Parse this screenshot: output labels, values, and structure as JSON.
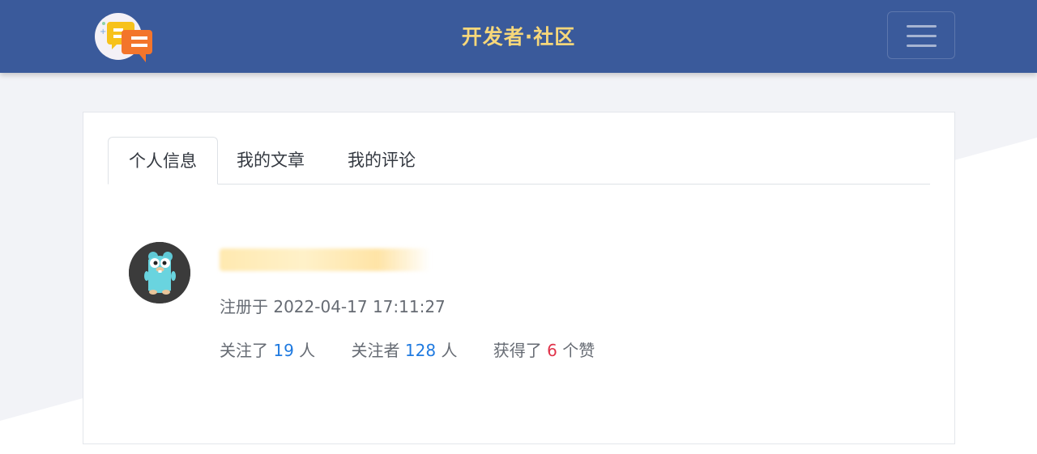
{
  "header": {
    "site_title": "开发者·社区",
    "logo_icon": "chat-bubbles-logo",
    "menu_icon": "hamburger-menu-icon",
    "bg_color": "#3a5a9b",
    "title_color": "#f6d77a"
  },
  "tabs": [
    {
      "label": "个人信息",
      "active": true
    },
    {
      "label": "我的文章",
      "active": false
    },
    {
      "label": "我的评论",
      "active": false
    }
  ],
  "profile": {
    "avatar_icon": "gopher-avatar",
    "registered": "注册于 2022-04-17 17:11:27",
    "following_prefix": "关注了",
    "following_count": "19",
    "following_suffix": "人",
    "followers_prefix": "关注者",
    "followers_count": "128",
    "followers_suffix": "人",
    "likes_prefix": "获得了",
    "likes_count": "6",
    "likes_suffix": "个赞"
  },
  "colors": {
    "accent_blue": "#1f7ae0",
    "accent_red": "#e0334a"
  }
}
